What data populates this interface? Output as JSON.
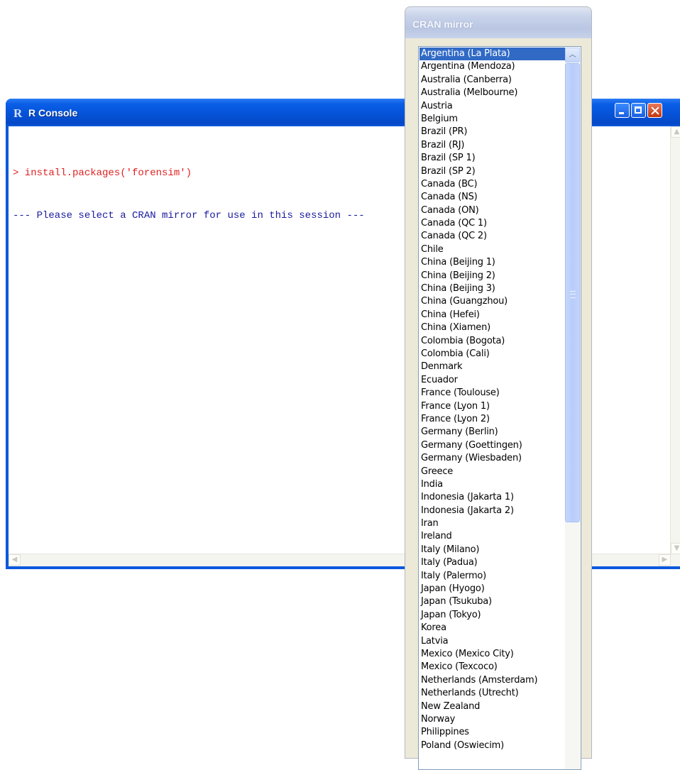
{
  "console": {
    "title": "R Console",
    "lines": [
      "> install.packages('forensim')",
      "--- Please select a CRAN mirror for use in this session ---"
    ],
    "colors": {
      "command": "#e02020",
      "message": "#1a1aa0"
    }
  },
  "cran": {
    "title": "CRAN mirror",
    "selected": "Argentina (La Plata)",
    "mirrors": [
      "Argentina (La Plata)",
      "Argentina (Mendoza)",
      "Australia (Canberra)",
      "Australia (Melbourne)",
      "Austria",
      "Belgium",
      "Brazil (PR)",
      "Brazil (RJ)",
      "Brazil (SP 1)",
      "Brazil (SP 2)",
      "Canada (BC)",
      "Canada (NS)",
      "Canada (ON)",
      "Canada (QC 1)",
      "Canada (QC 2)",
      "Chile",
      "China (Beijing 1)",
      "China (Beijing 2)",
      "China (Beijing 3)",
      "China (Guangzhou)",
      "China (Hefei)",
      "China (Xiamen)",
      "Colombia (Bogota)",
      "Colombia (Cali)",
      "Denmark",
      "Ecuador",
      "France (Toulouse)",
      "France (Lyon 1)",
      "France (Lyon 2)",
      "Germany (Berlin)",
      "Germany (Goettingen)",
      "Germany (Wiesbaden)",
      "Greece",
      "India",
      "Indonesia (Jakarta 1)",
      "Indonesia (Jakarta 2)",
      "Iran",
      "Ireland",
      "Italy (Milano)",
      "Italy (Padua)",
      "Italy (Palermo)",
      "Japan (Hyogo)",
      "Japan (Tsukuba)",
      "Japan (Tokyo)",
      "Korea",
      "Latvia",
      "Mexico (Mexico City)",
      "Mexico (Texcoco)",
      "Netherlands (Amsterdam)",
      "Netherlands (Utrecht)",
      "New Zealand",
      "Norway",
      "Philippines",
      "Poland (Oswiecim)"
    ]
  }
}
